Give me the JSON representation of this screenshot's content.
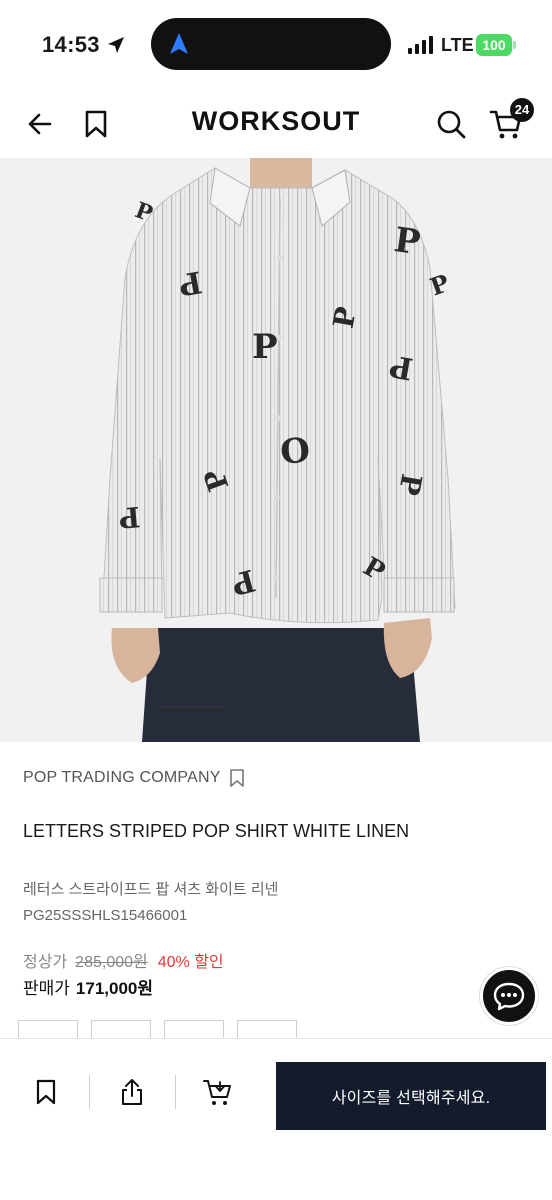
{
  "status_bar": {
    "time": "14:53",
    "network": "LTE",
    "battery": "100"
  },
  "header": {
    "brand": "WORKSOUT",
    "cart_count": "24"
  },
  "product": {
    "brand_name": "POP TRADING COMPANY",
    "name": "LETTERS STRIPED POP SHIRT WHITE LINEN",
    "name_ko": "레터스 스트라이프드 팝 셔츠 화이트 리넨",
    "code": "PG25SSSHLS15466001",
    "regular_price_label": "정상가",
    "regular_price": "285,000원",
    "discount": "40% 할인",
    "sale_price_label": "판매가",
    "sale_price": "171,000원"
  },
  "bottom_bar": {
    "size_button_label": "사이즈를 선택해주세요."
  },
  "colors": {
    "primary_dark": "#141b2d",
    "discount_red": "#e03a3a",
    "battery_green": "#4cd964"
  }
}
